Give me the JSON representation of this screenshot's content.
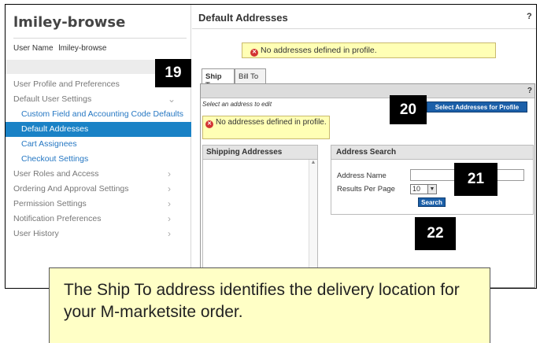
{
  "sidebar": {
    "title": "lmiley-browse",
    "user_label": "User Name",
    "user_value": "lmiley-browse",
    "items": [
      {
        "label": "User Profile and Preferences"
      },
      {
        "label": "Default User Settings",
        "chevron": "v"
      },
      {
        "label": "Custom Field and Accounting Code Defaults"
      },
      {
        "label": "Default Addresses"
      },
      {
        "label": "Cart Assignees"
      },
      {
        "label": "Checkout Settings"
      },
      {
        "label": "User Roles and Access",
        "chevron": ">"
      },
      {
        "label": "Ordering And Approval Settings",
        "chevron": ">"
      },
      {
        "label": "Permission Settings",
        "chevron": ">"
      },
      {
        "label": "Notification Preferences",
        "chevron": ">"
      },
      {
        "label": "User History",
        "chevron": ">"
      }
    ]
  },
  "main": {
    "title": "Default Addresses",
    "help": "?",
    "warning": "No addresses defined in profile.",
    "tabs": [
      {
        "label": "Ship To"
      },
      {
        "label": "Bill To"
      }
    ],
    "panel": {
      "help": "?",
      "select_hint": "Select an address to edit",
      "select_button": "Select Addresses for Profile",
      "warning": "No addresses defined in profile.",
      "shipping_header": "Shipping Addresses",
      "search": {
        "header": "Address Search",
        "name_label": "Address Name",
        "results_label": "Results Per Page",
        "results_value": "10",
        "button": "Search"
      }
    }
  },
  "callouts": {
    "c19": "19",
    "c20": "20",
    "c21": "21",
    "c22": "22"
  },
  "note": "The Ship To address identifies the delivery location for your M-marketsite order.",
  "colors": {
    "accent": "#1a82c6",
    "button": "#1b5fa8",
    "warning_bg": "#ffffb5",
    "note_bg": "#ffffc6"
  }
}
